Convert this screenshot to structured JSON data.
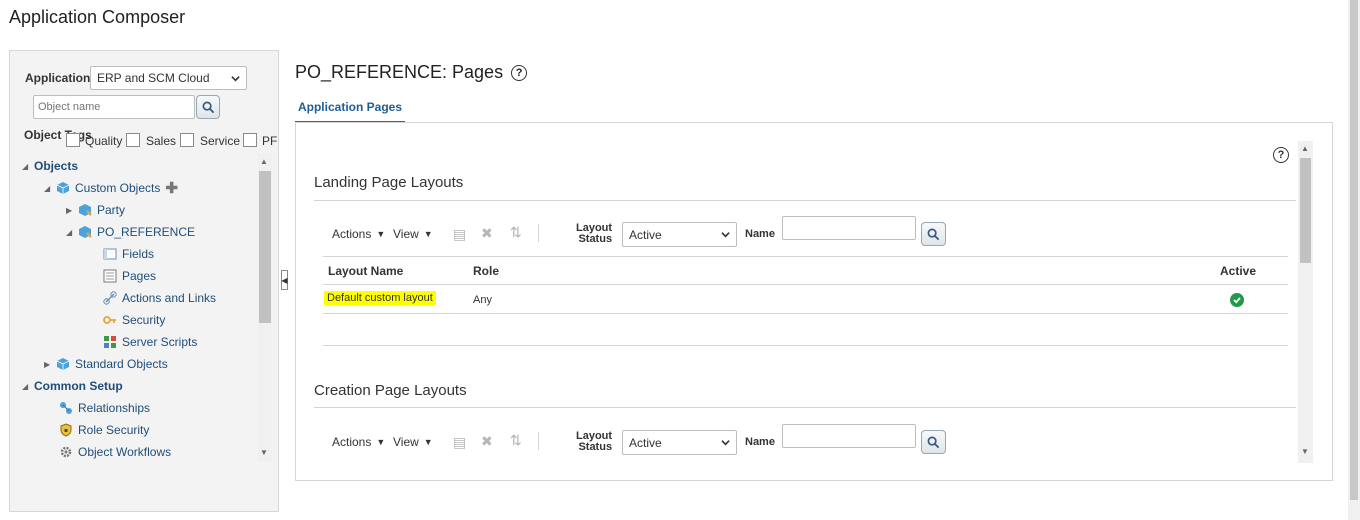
{
  "app_title": "Application Composer",
  "left": {
    "application_label": "Application",
    "application_value": "ERP and SCM Cloud",
    "search_placeholder": "Object name",
    "object_tags_label": "Object Tags",
    "tags": [
      "Quality",
      "Sales",
      "Service",
      "PF"
    ],
    "tree": {
      "objects": "Objects",
      "custom_objects": "Custom Objects",
      "party": "Party",
      "po_reference": "PO_REFERENCE",
      "fields": "Fields",
      "pages": "Pages",
      "actions_links": "Actions and Links",
      "security": "Security",
      "server_scripts": "Server Scripts",
      "standard_objects": "Standard Objects",
      "common_setup": "Common Setup",
      "relationships": "Relationships",
      "role_security": "Role Security",
      "object_workflows": "Object Workflows"
    }
  },
  "main": {
    "title": "PO_REFERENCE: Pages",
    "help_glyph": "?",
    "tab_label": "Application Pages",
    "sections": [
      {
        "title": "Landing Page Layouts",
        "actions_label": "Actions",
        "view_label": "View",
        "layout_status_label_1": "Layout",
        "layout_status_label_2": "Status",
        "layout_status_value": "Active",
        "name_label": "Name",
        "name_value": "",
        "columns": [
          "Layout Name",
          "Role",
          "Active"
        ],
        "rows": [
          {
            "layout_name": "Default custom layout",
            "role": "Any",
            "active": true
          }
        ]
      },
      {
        "title": "Creation Page Layouts",
        "actions_label": "Actions",
        "view_label": "View",
        "layout_status_label_1": "Layout",
        "layout_status_label_2": "Status",
        "layout_status_value": "Active",
        "name_label": "Name",
        "name_value": ""
      }
    ]
  },
  "colors": {
    "accent": "#1f5e95",
    "highlight": "#ffff00",
    "active_check": "#1f9a4a"
  }
}
